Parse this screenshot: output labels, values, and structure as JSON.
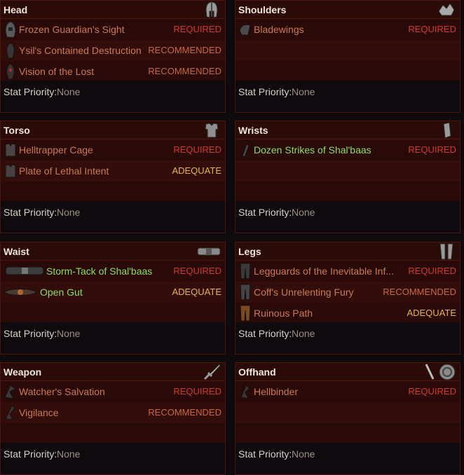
{
  "stat_label": "Stat Priority:",
  "stat_value": "None",
  "slots": [
    {
      "title": "Head",
      "icon": "helmet-icon",
      "items": [
        {
          "name": "Frozen Guardian's Sight",
          "tier": "REQUIRED",
          "set": false
        },
        {
          "name": "Ysil's Contained Destruction",
          "tier": "RECOMMENDED",
          "set": false
        },
        {
          "name": "Vision of the Lost",
          "tier": "RECOMMENDED",
          "set": false
        }
      ]
    },
    {
      "title": "Shoulders",
      "icon": "shoulders-icon",
      "items": [
        {
          "name": "Bladewings",
          "tier": "REQUIRED",
          "set": false
        }
      ]
    },
    {
      "title": "Torso",
      "icon": "torso-icon",
      "items": [
        {
          "name": "Helltrapper Cage",
          "tier": "REQUIRED",
          "set": false
        },
        {
          "name": "Plate of Lethal Intent",
          "tier": "ADEQUATE",
          "set": false
        }
      ]
    },
    {
      "title": "Wrists",
      "icon": "wrists-icon",
      "items": [
        {
          "name": "Dozen Strikes of Shal'baas",
          "tier": "REQUIRED",
          "set": true
        }
      ]
    },
    {
      "title": "Waist",
      "icon": "belt-icon",
      "items": [
        {
          "name": "Storm-Tack of Shal'baas",
          "tier": "REQUIRED",
          "set": true
        },
        {
          "name": "Open Gut",
          "tier": "ADEQUATE",
          "set": true
        }
      ]
    },
    {
      "title": "Legs",
      "icon": "legs-icon",
      "items": [
        {
          "name": "Legguards of the Inevitable Inf...",
          "tier": "REQUIRED",
          "set": false
        },
        {
          "name": "Coff's Unrelenting Fury",
          "tier": "RECOMMENDED",
          "set": false
        },
        {
          "name": "Ruinous Path",
          "tier": "ADEQUATE",
          "set": false
        }
      ]
    },
    {
      "title": "Weapon",
      "icon": "dagger-icon",
      "items": [
        {
          "name": "Watcher's Salvation",
          "tier": "REQUIRED",
          "set": false
        },
        {
          "name": "Vigilance",
          "tier": "RECOMMENDED",
          "set": false
        }
      ]
    },
    {
      "title": "Offhand",
      "icon": "offhand-icon",
      "items": [
        {
          "name": "Hellbinder",
          "tier": "REQUIRED",
          "set": false
        }
      ]
    }
  ]
}
